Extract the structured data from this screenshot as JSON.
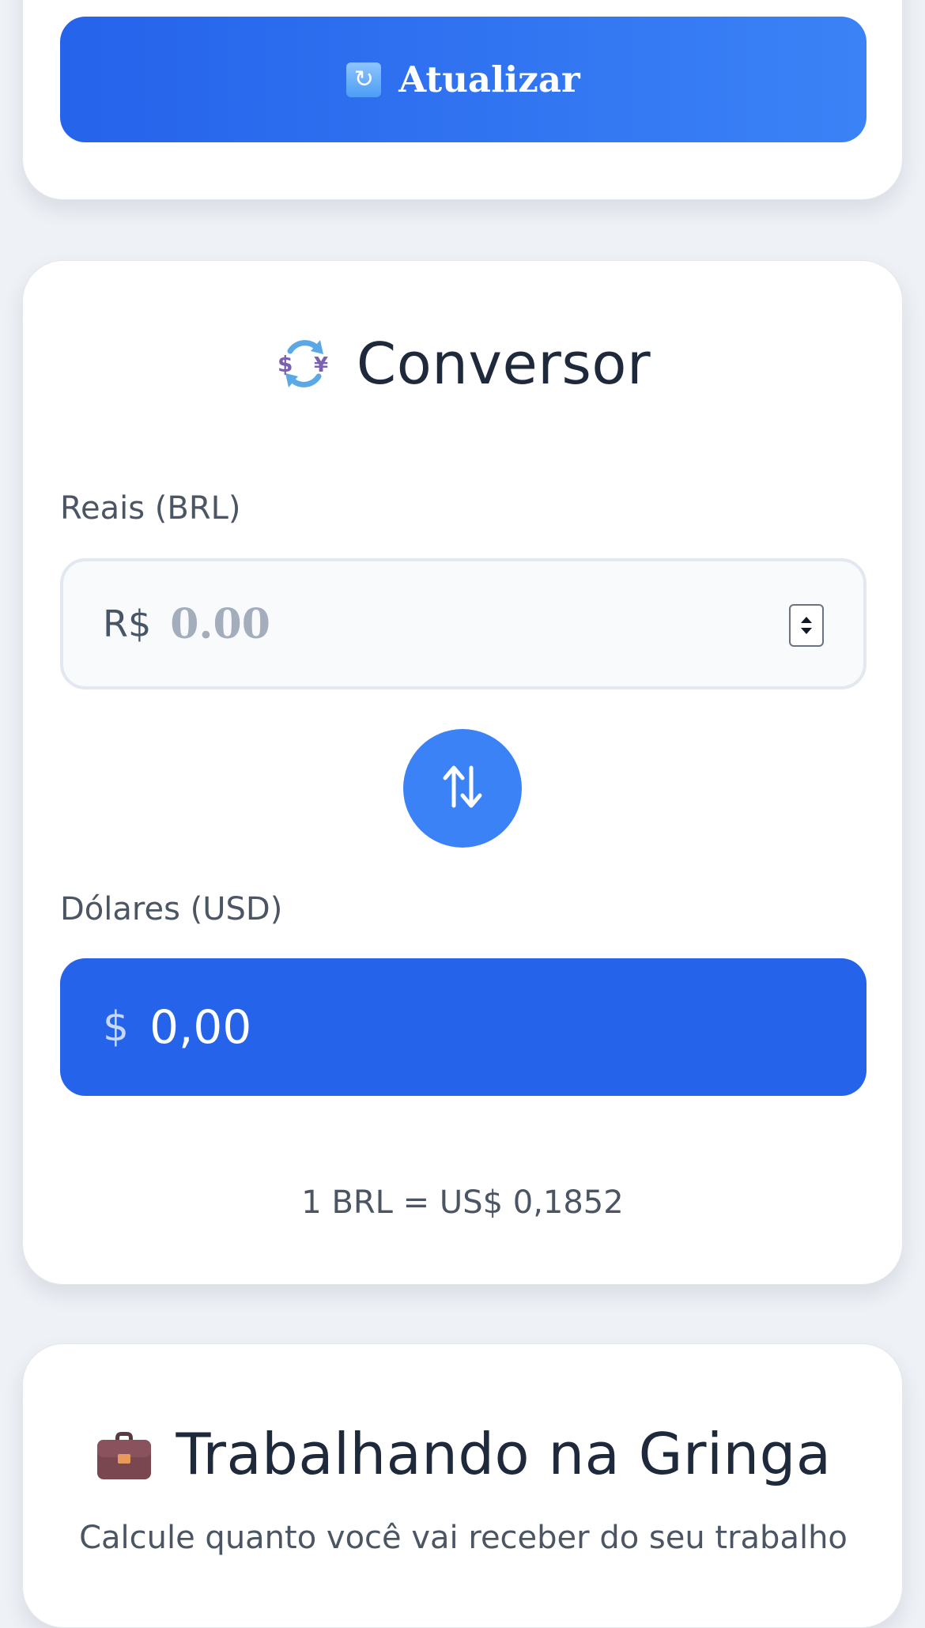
{
  "refresh": {
    "label": "Atualizar",
    "icon": "refresh-icon"
  },
  "converter": {
    "title": "Conversor",
    "icon": "currency-exchange-icon",
    "brl_label": "Reais (BRL)",
    "brl_prefix": "R$",
    "brl_placeholder": "0.00",
    "brl_value": "",
    "swap_icon": "swap-arrows-icon",
    "usd_label": "Dólares (USD)",
    "usd_prefix": "$",
    "usd_value": "0,00",
    "rate": "1 BRL = US$ 0,1852"
  },
  "work": {
    "title": "Trabalhando na Gringa",
    "icon": "briefcase-icon",
    "subtitle": "Calcule quanto você vai receber do seu trabalho"
  },
  "colors": {
    "accent": "#2563eb",
    "accent_light": "#3b82f6",
    "background": "#eef1f6",
    "card": "#ffffff",
    "text": "#1e293b",
    "muted_text": "#4b5563"
  }
}
